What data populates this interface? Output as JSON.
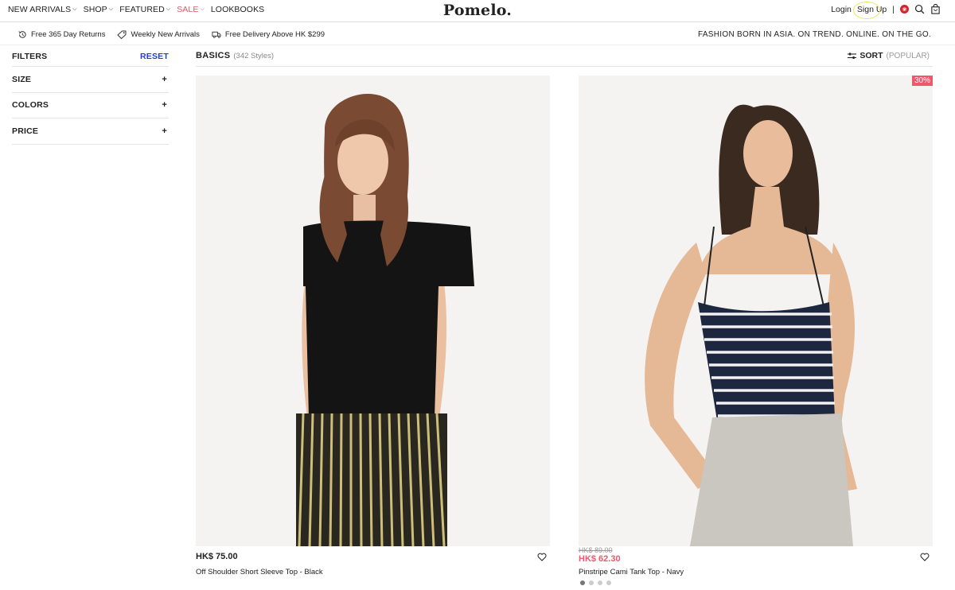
{
  "nav": {
    "items": [
      {
        "label": "NEW ARRIVALS",
        "has_dropdown": true
      },
      {
        "label": "SHOP",
        "has_dropdown": true
      },
      {
        "label": "FEATURED",
        "has_dropdown": true
      },
      {
        "label": "SALE",
        "has_dropdown": true,
        "color": "#e0566a"
      },
      {
        "label": "LOOKBOOKS",
        "has_dropdown": false
      }
    ],
    "logo": "Pomelo.",
    "login": "Login",
    "signup": "Sign Up",
    "separator": "|",
    "icons": [
      "flag-icon",
      "search-icon",
      "cart-icon"
    ]
  },
  "infobar": {
    "perks": [
      {
        "icon": "clock-return-icon",
        "label": "Free 365 Day Returns"
      },
      {
        "icon": "tag-icon",
        "label": "Weekly New Arrivals"
      },
      {
        "icon": "truck-icon",
        "label": "Free Delivery Above HK $299"
      }
    ],
    "tagline": "FASHION BORN IN ASIA. ON TREND. ONLINE. ON THE GO."
  },
  "sidebar": {
    "title": "FILTERS",
    "reset": "RESET",
    "reset_color": "#2a3bcf",
    "filters": [
      {
        "label": "SIZE",
        "toggle": "+"
      },
      {
        "label": "COLORS",
        "toggle": "+"
      },
      {
        "label": "PRICE",
        "toggle": "+"
      }
    ]
  },
  "main": {
    "category": "BASICS",
    "count": "(342 Styles)",
    "sort_label": "SORT",
    "sort_value": "(POPULAR)"
  },
  "products": [
    {
      "price": "HK$ 75.00",
      "name": "Off Shoulder Short Sleeve Top - Black"
    },
    {
      "badge": "30%",
      "old_price": "HK$ 89.00",
      "sale_price": "HK$ 62.30",
      "name": "Pinstripe Cami Tank Top - Navy",
      "color_dots": 4,
      "sale_color": "#f0576c"
    }
  ]
}
